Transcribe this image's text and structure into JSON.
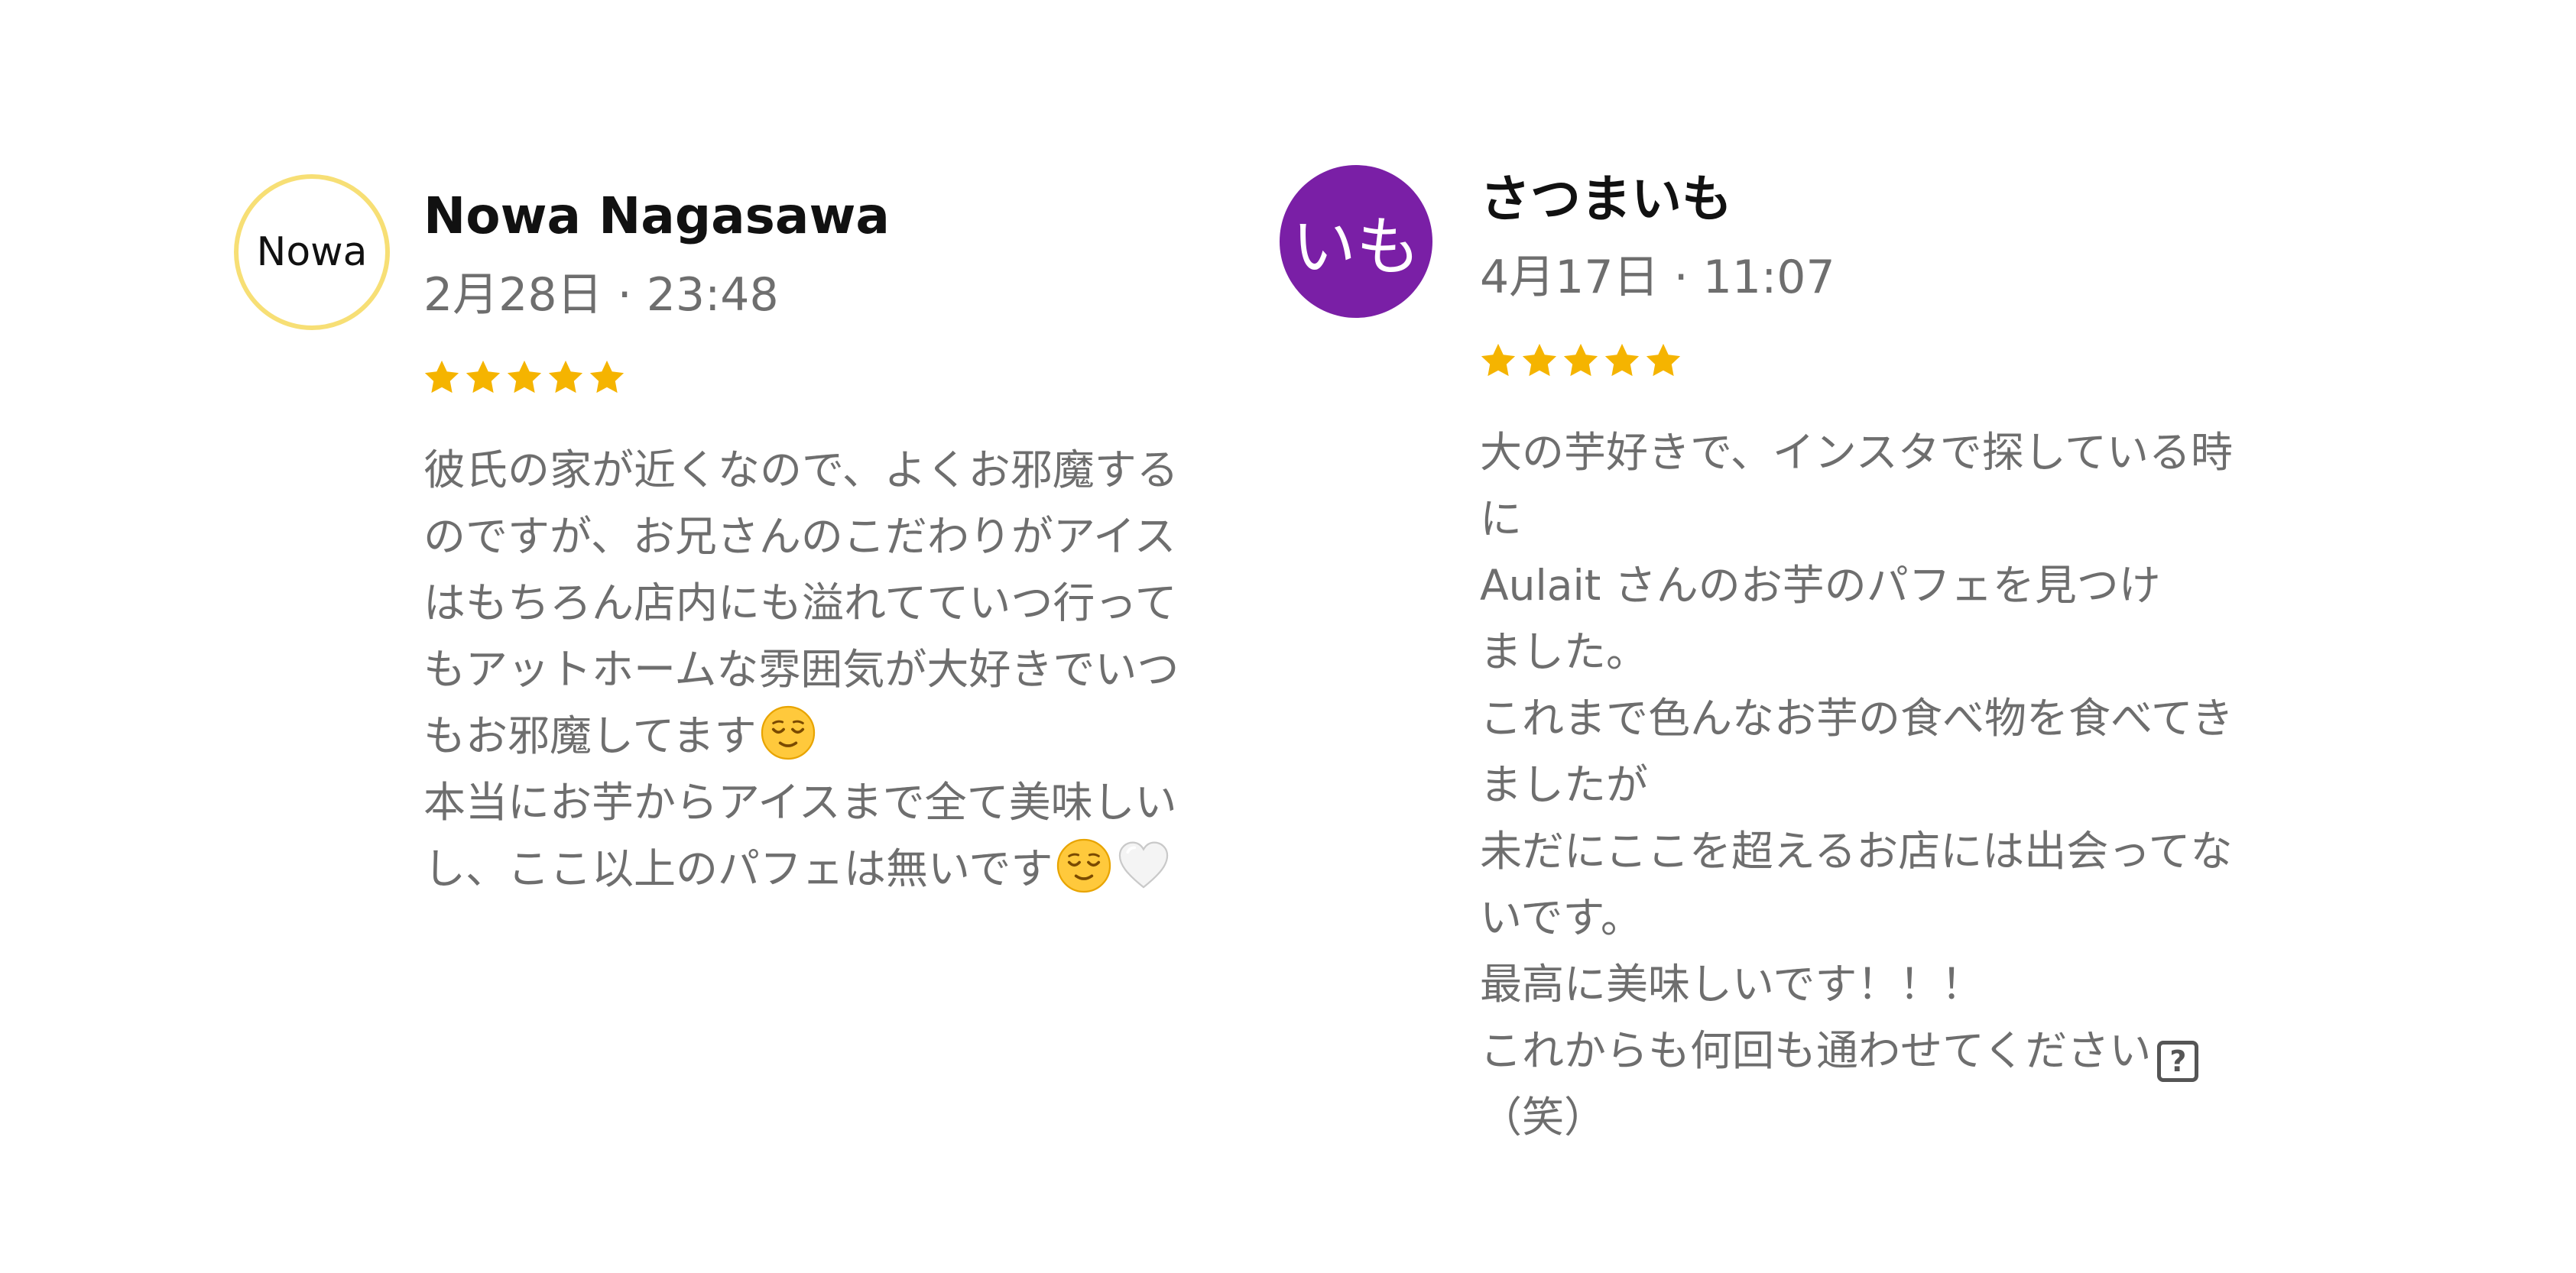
{
  "reviews": [
    {
      "avatar_text": "Nowa",
      "avatar_border_color": "#f7df75",
      "name": "Nowa Nagasawa",
      "date": "2月28日 · 23:48",
      "rating": 5,
      "text_lines": [
        "彼氏の家が近くなので、よくお邪魔する",
        "のですが、お兄さんのこだわりがアイス",
        "はもちろん店内にも溢れてていつ行って",
        "もアットホームな雰囲気が大好きでいつ",
        "もお邪魔してます",
        "本当にお芋からアイスまで全て美味しい",
        "し、ここ以上のパフェは無いです"
      ],
      "emojis": [
        "relieved-face-emoji",
        "relieved-face-emoji",
        "white-heart-emoji"
      ]
    },
    {
      "avatar_text": "いも",
      "avatar_bg_color": "#7a1fa6",
      "name": "さつまいも",
      "date": "4月17日 · 11:07",
      "rating": 5,
      "text_lines": [
        "大の芋好きで、インスタで探している時",
        "に",
        "Aulait さんのお芋のパフェを見つけ",
        "ました。",
        "これまで色んなお芋の食べ物を食べてき",
        "ましたが",
        "未だにここを超えるお店には出会ってな",
        "いです。",
        "最高に美味しいです！！！",
        "これからも何回も通わせてください",
        "（笑）"
      ],
      "missing_glyph": "?"
    }
  ],
  "colors": {
    "star": "#f5b400",
    "name_text": "#111111",
    "secondary_text": "#6e6e6e"
  }
}
